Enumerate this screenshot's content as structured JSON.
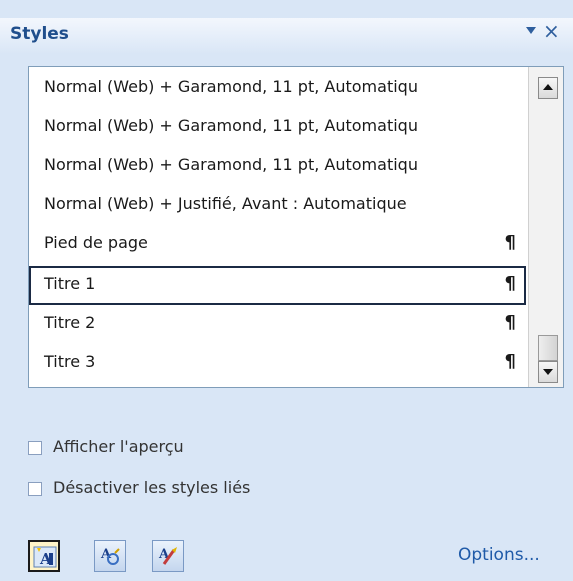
{
  "pane": {
    "title": "Styles",
    "close_glyph": "×",
    "accent_color": "#1f4e8c"
  },
  "styles_list": {
    "items": [
      {
        "label": "Normal (Web) + Garamond, 11 pt, Automatiqu",
        "mark": ""
      },
      {
        "label": "Normal (Web) + Garamond, 11 pt, Automatiqu",
        "mark": ""
      },
      {
        "label": "Normal (Web) + Garamond, 11 pt, Automatiqu",
        "mark": ""
      },
      {
        "label": "Normal (Web) + Justifié, Avant : Automatique",
        "mark": ""
      },
      {
        "label": "Pied de page",
        "mark": "¶"
      },
      {
        "label": "Titre 1",
        "mark": "¶",
        "selected": true
      },
      {
        "label": "Titre 2",
        "mark": "¶"
      },
      {
        "label": "Titre 3",
        "mark": "¶"
      }
    ]
  },
  "checkboxes": {
    "preview": {
      "label": "Afficher l'aperçu",
      "checked": false
    },
    "disable_linked": {
      "label": "Désactiver les styles liés",
      "checked": false
    }
  },
  "toolbar": {
    "new_style_icon": "new-style-icon",
    "style_inspector_icon": "style-inspector-icon",
    "manage_styles_icon": "manage-styles-icon",
    "options_label": "Options..."
  }
}
